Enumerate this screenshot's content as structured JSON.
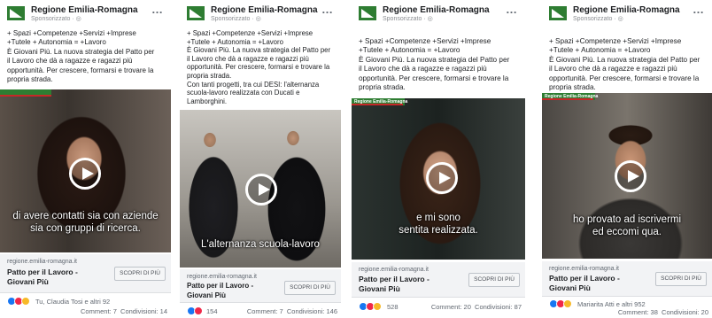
{
  "posts": [
    {
      "page_name": "Regione Emilia-Romagna",
      "sponsored": "Sponsorizzato · ◎",
      "menu": "…",
      "body": [
        "+ Spazi +Competenze +Servizi +Imprese",
        "+Tutele + Autonomia = +Lavoro",
        "È Giovani Più. La nuova strategia del Patto per",
        "il Lavoro che dà a ragazze e ragazzi più",
        "opportunità. Per crescere, formarsi e trovare la",
        "propria strada."
      ],
      "subtitle": [
        "di avere contatti sia con aziende",
        "sia con gruppi di ricerca."
      ],
      "video_label": "",
      "domain": "regione.emilia-romagna.it",
      "link_title": [
        "Patto per il Lavoro -",
        "Giovani Più"
      ],
      "cta": "SCOPRI DI PIÙ",
      "reactions_text": "Tu, Claudia Tosi e altri 92",
      "comments": "Comment: 7",
      "shares": "Condivisioni: 14"
    },
    {
      "page_name": "Regione Emilia-Romagna",
      "sponsored": "Sponsorizzato · ◎",
      "menu": "…",
      "body": [
        "+ Spazi +Competenze +Servizi +Imprese",
        "+Tutele + Autonomia = +Lavoro",
        "È Giovani Più. La nuova strategia del Patto per",
        "il Lavoro che dà a ragazze e ragazzi più",
        "opportunità. Per crescere, formarsi e trovare la",
        "propria strada.",
        "Con tanti progetti, tra cui DESI: l'alternanza",
        "scuola-lavoro realizzata con Ducati e",
        "Lamborghini."
      ],
      "subtitle": [
        "L'alternanza scuola-lavoro"
      ],
      "video_label": "",
      "domain": "regione.emilia-romagna.it",
      "link_title": [
        "Patto per il Lavoro -",
        "Giovani Più"
      ],
      "cta": "SCOPRI DI PIÙ",
      "reactions_text": "154",
      "comments": "Comment: 7",
      "shares": "Condivisioni: 146"
    },
    {
      "page_name": "Regione Emilia-Romagna",
      "sponsored": "Sponsorizzato · ◎",
      "menu": "…",
      "body": [
        "+ Spazi +Competenze +Servizi +Imprese",
        "+Tutele + Autonomia = +Lavoro",
        "È Giovani Più. La nuova strategia del Patto per",
        "il Lavoro che dà a ragazze e ragazzi più",
        "opportunità. Per crescere, formarsi e trovare la",
        "propria strada."
      ],
      "subtitle": [
        "e mi sono",
        "sentita realizzata."
      ],
      "video_label": "Regione Emilia-Romagna",
      "domain": "regione.emilia-romagna.it",
      "link_title": [
        "Patto per il Lavoro -",
        "Giovani Più"
      ],
      "cta": "SCOPRI DI PIÙ",
      "reactions_text": "528",
      "comments": "Comment: 20",
      "shares": "Condivisioni: 87"
    },
    {
      "page_name": "Regione Emilia-Romagna",
      "sponsored": "Sponsorizzato · ◎",
      "menu": "…",
      "body": [
        "+ Spazi +Competenze +Servizi +Imprese",
        "+Tutele + Autonomia = +Lavoro",
        "È Giovani Più. La nuova strategia del Patto per",
        "il Lavoro che dà a ragazze e ragazzi più",
        "opportunità. Per crescere, formarsi e trovare la",
        "propria strada."
      ],
      "subtitle": [
        "ho provato ad iscrivermi",
        "ed eccomi qua."
      ],
      "video_label": "Regione Emilia-Romagna",
      "domain": "regione.emilia-romagna.it",
      "link_title": [
        "Patto per il Lavoro -",
        "Giovani Più"
      ],
      "cta": "SCOPRI DI PIÙ",
      "reactions_text": "Mariarita Atti e altri 952",
      "comments": "Comment: 38",
      "shares": "Condivisioni: 20"
    }
  ],
  "colors": {
    "brand_green": "#2e7d32",
    "like_blue": "#1877f2",
    "love_red": "#f02849",
    "wow_yellow": "#f7b928"
  }
}
